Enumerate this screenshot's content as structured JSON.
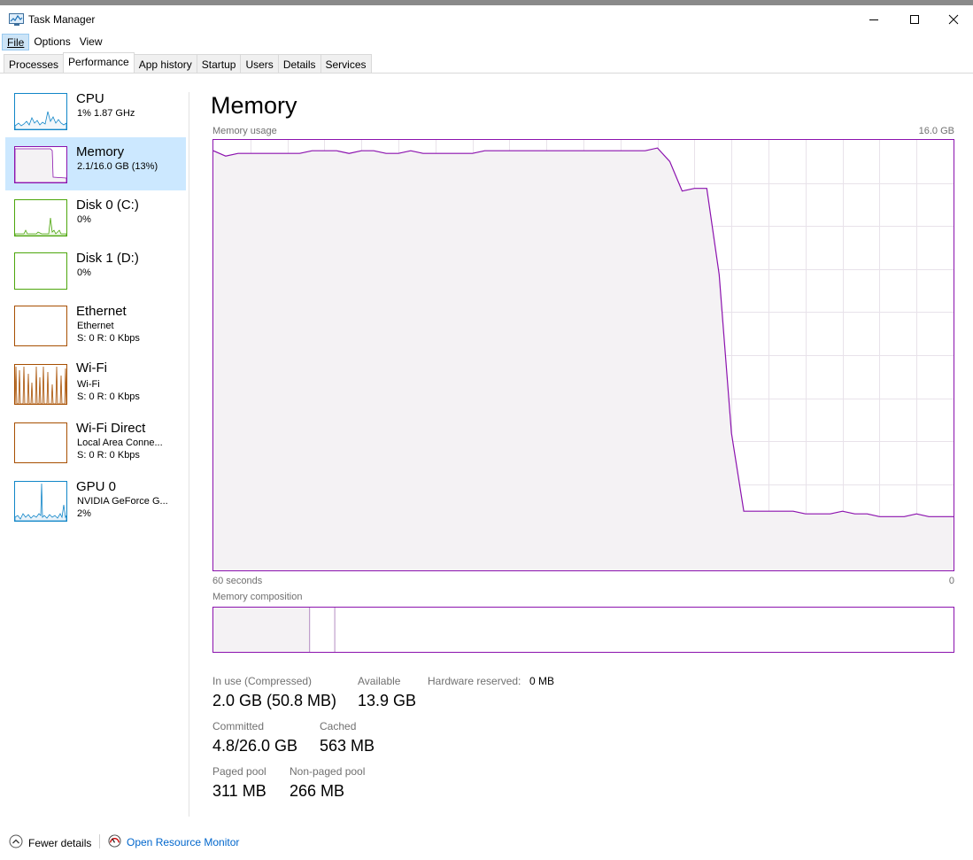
{
  "window": {
    "title": "Task Manager",
    "icon": "task-manager-icon"
  },
  "menu": {
    "file": "File",
    "options": "Options",
    "view": "View"
  },
  "tabs": [
    "Processes",
    "Performance",
    "App history",
    "Startup",
    "Users",
    "Details",
    "Services"
  ],
  "selected_tab": "Performance",
  "sidebar": {
    "items": [
      {
        "title": "CPU",
        "sub1": "1% 1.87 GHz",
        "sub2": "",
        "color": "#1186c8"
      },
      {
        "title": "Memory",
        "sub1": "2.1/16.0 GB (13%)",
        "sub2": "",
        "color": "#8b12ae"
      },
      {
        "title": "Disk 0 (C:)",
        "sub1": "0%",
        "sub2": "",
        "color": "#4da60c"
      },
      {
        "title": "Disk 1 (D:)",
        "sub1": "0%",
        "sub2": "",
        "color": "#4da60c"
      },
      {
        "title": "Ethernet",
        "sub1": "Ethernet",
        "sub2": "S: 0 R: 0 Kbps",
        "color": "#a74f01"
      },
      {
        "title": "Wi-Fi",
        "sub1": "Wi-Fi",
        "sub2": "S: 0 R: 0 Kbps",
        "color": "#a74f01"
      },
      {
        "title": "Wi-Fi Direct",
        "sub1": "Local Area Conne...",
        "sub2": "S: 0 R: 0 Kbps",
        "color": "#a74f01"
      },
      {
        "title": "GPU 0",
        "sub1": "NVIDIA GeForce G...",
        "sub2": "2%",
        "color": "#1186c8"
      }
    ]
  },
  "main": {
    "title": "Memory",
    "usage_label": "Memory usage",
    "usage_max": "16.0 GB",
    "x_left": "60 seconds",
    "x_right": "0",
    "composition_label": "Memory composition",
    "accent": "#8b12ae"
  },
  "chart_data": {
    "type": "area",
    "title": "Memory usage",
    "ylabel": "",
    "xlabel": "",
    "ylim": [
      0,
      16
    ],
    "y_unit": "GB",
    "x": [
      60,
      59,
      58,
      57,
      56,
      55,
      54,
      53,
      52,
      51,
      50,
      49,
      48,
      47,
      46,
      45,
      44,
      43,
      42,
      41,
      40,
      39,
      38,
      37,
      36,
      35,
      34,
      33,
      32,
      31,
      30,
      29,
      28,
      27,
      26,
      25,
      24,
      23,
      22,
      21,
      20,
      19,
      18,
      17,
      16,
      15,
      14,
      13,
      12,
      11,
      10,
      9,
      8,
      7,
      6,
      5,
      4,
      3,
      2,
      1,
      0
    ],
    "series": [
      {
        "values": [
          15.6,
          15.4,
          15.5,
          15.5,
          15.5,
          15.5,
          15.5,
          15.5,
          15.6,
          15.6,
          15.6,
          15.5,
          15.6,
          15.6,
          15.5,
          15.5,
          15.6,
          15.5,
          15.5,
          15.5,
          15.5,
          15.5,
          15.6,
          15.6,
          15.6,
          15.6,
          15.6,
          15.6,
          15.6,
          15.6,
          15.6,
          15.6,
          15.6,
          15.6,
          15.6,
          15.6,
          15.7,
          15.2,
          14.1,
          14.2,
          14.2,
          11.0,
          5.1,
          2.2,
          2.2,
          2.2,
          2.2,
          2.2,
          2.1,
          2.1,
          2.1,
          2.2,
          2.1,
          2.1,
          2.0,
          2.0,
          2.0,
          2.1,
          2.0,
          2.0,
          2.0
        ]
      }
    ],
    "grid": true
  },
  "composition": {
    "in_use_fraction": 0.13,
    "modified_fraction": 0.003,
    "standby_fraction": 0.034
  },
  "stats": {
    "in_use_label": "In use (Compressed)",
    "in_use_value": "2.0 GB (50.8 MB)",
    "available_label": "Available",
    "available_value": "13.9 GB",
    "hw_reserved_label": "Hardware reserved:",
    "hw_reserved_value": "0 MB",
    "committed_label": "Committed",
    "committed_value": "4.8/26.0 GB",
    "cached_label": "Cached",
    "cached_value": "563 MB",
    "paged_label": "Paged pool",
    "paged_value": "311 MB",
    "nonpaged_label": "Non-paged pool",
    "nonpaged_value": "266 MB"
  },
  "footer": {
    "fewer_details": "Fewer details",
    "open_monitor": "Open Resource Monitor"
  }
}
